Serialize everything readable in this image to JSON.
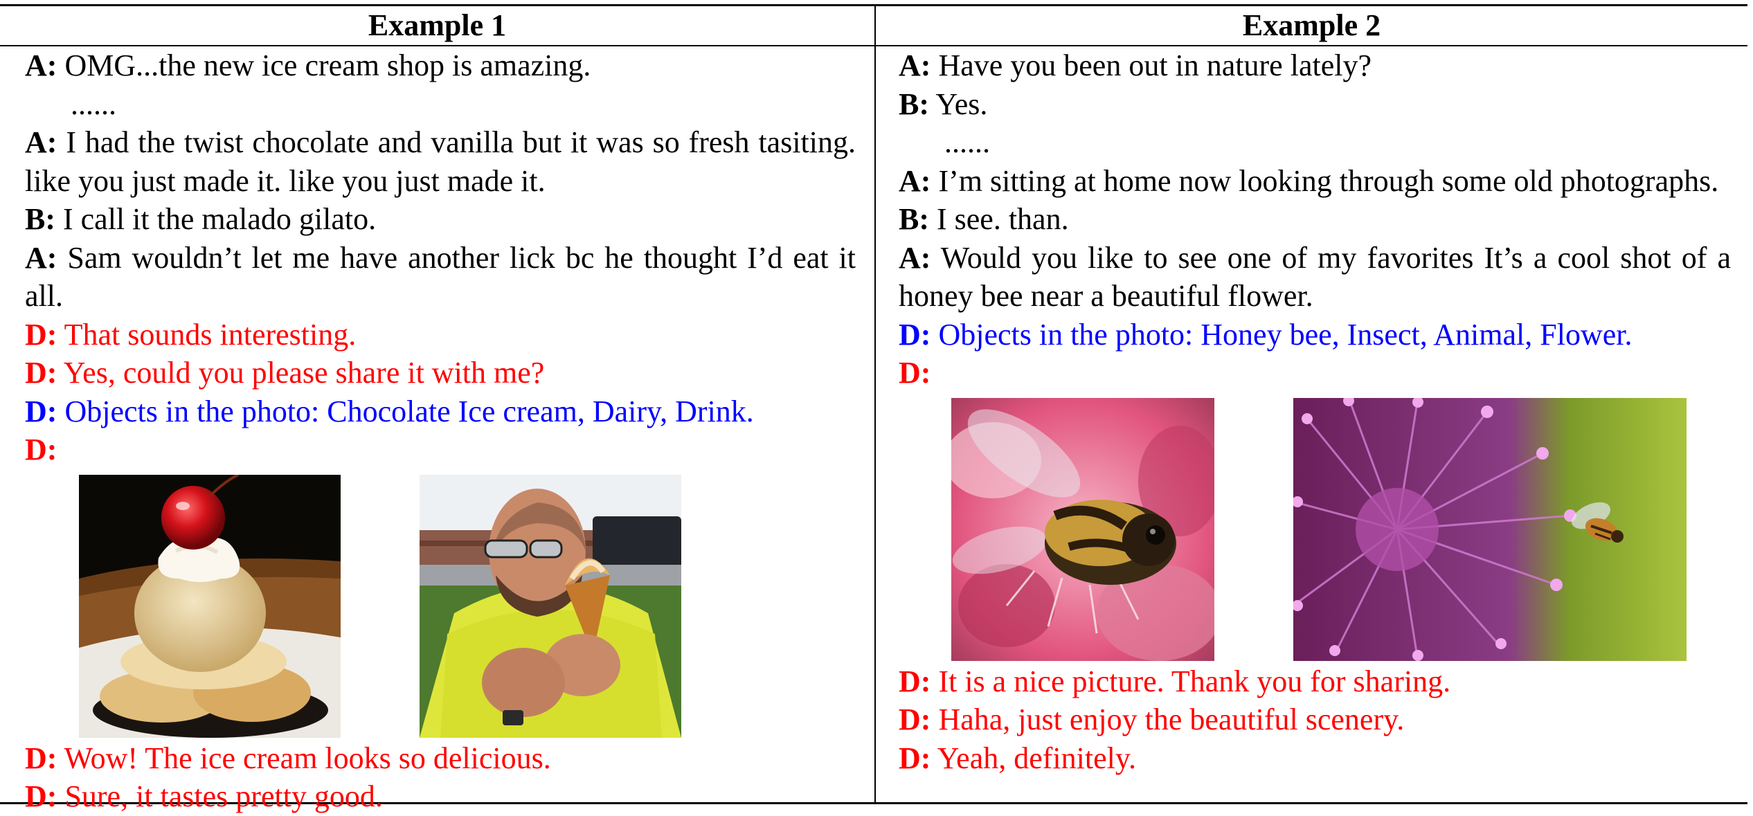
{
  "headers": [
    "Example 1",
    "Example 2"
  ],
  "example1": {
    "turns_before": [
      {
        "speaker": "A:",
        "text": " OMG...the new ice cream shop is amazing."
      },
      {
        "ellipsis": "......"
      },
      {
        "speaker": "A:",
        "text": " I had the twist chocolate and vanilla but it was so fresh tasiting. like you just made it. like you just made it."
      },
      {
        "speaker": "B:",
        "text": " I call it the malado gilato."
      },
      {
        "speaker": "A:",
        "text": " Sam wouldn’t let me have another lick bc he thought I’d eat it all."
      },
      {
        "speaker": "D:",
        "text": " That sounds interesting."
      },
      {
        "speaker": "D:",
        "text": " Yes, could you please share it with me?"
      },
      {
        "speaker": "D:",
        "text": " Objects in the photo: Chocolate Ice cream, Dairy, Drink."
      },
      {
        "speaker": "D:",
        "text": ""
      }
    ],
    "images": [
      "ice-cream-dessert-photo",
      "man-holding-ice-cream-photo"
    ],
    "turns_after": [
      {
        "speaker": "D:",
        "text": " Wow! The ice cream looks so delicious."
      },
      {
        "speaker": "D:",
        "text": " Sure, it tastes pretty good."
      }
    ]
  },
  "example2": {
    "turns_before": [
      {
        "speaker": "A:",
        "text": " Have you been out in nature lately?"
      },
      {
        "speaker": "B:",
        "text": " Yes."
      },
      {
        "ellipsis": "......"
      },
      {
        "speaker": "A:",
        "text": " I’m sitting at home now looking through some old photographs."
      },
      {
        "speaker": "B:",
        "text": " I see. than."
      },
      {
        "speaker": "A:",
        "text": " Would you like to see one of my favorites It’s a cool shot of a honey bee near a beautiful flower."
      },
      {
        "speaker": "D:",
        "text": " Objects in the photo: Honey bee, Insect, Animal, Flower."
      },
      {
        "speaker": "D:",
        "text": ""
      }
    ],
    "images": [
      "bee-on-pink-flower-photo",
      "bee-near-purple-allium-photo"
    ],
    "turns_after": [
      {
        "speaker": "D:",
        "text": " It is a nice picture. Thank you for sharing."
      },
      {
        "speaker": "D:",
        "text": " Haha, just enjoy the beautiful scenery."
      },
      {
        "speaker": "D:",
        "text": " Yeah, definitely."
      }
    ]
  },
  "colors": {
    "system_red": "#ff0000",
    "object_blue": "#0000ff",
    "human_black": "#000000"
  }
}
